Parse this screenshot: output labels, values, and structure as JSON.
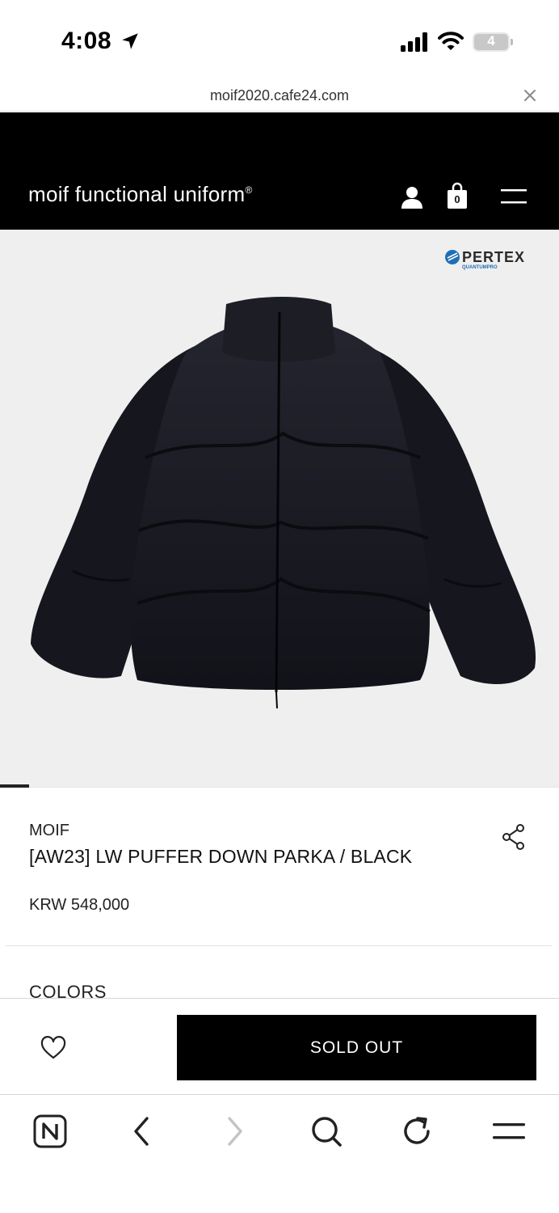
{
  "status_bar": {
    "time": "4:08",
    "battery": "4"
  },
  "browser": {
    "url": "moif2020.cafe24.com"
  },
  "site": {
    "logo": "moif functional uniform",
    "logo_mark": "®",
    "cart_count": "0"
  },
  "product": {
    "badge": "PERTEX",
    "badge_sub": "QUANTUMPRO",
    "brand": "MOIF",
    "name": "[AW23] LW PUFFER DOWN PARKA / BLACK",
    "price": "KRW 548,000",
    "colors_label": "COLORS",
    "image_alt": "black puffer down parka"
  },
  "actions": {
    "sold_out_label": "SOLD OUT"
  },
  "colors": {
    "header_bg": "#000000",
    "hero_bg": "#efefef",
    "button_bg": "#000000"
  }
}
